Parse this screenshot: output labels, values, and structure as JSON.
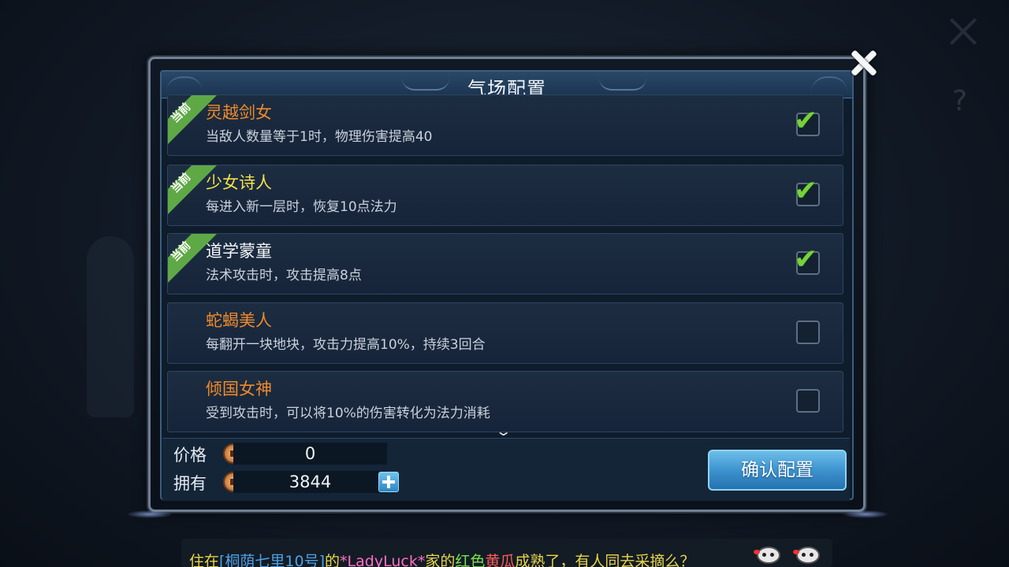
{
  "dialog": {
    "title": "气场配置"
  },
  "badge_text": "当前",
  "items": [
    {
      "name": "灵越剑女",
      "desc": "当敌人数量等于1时，物理伤害提高40",
      "current": true,
      "checked": true,
      "name_color": "#f08a2a"
    },
    {
      "name": "少女诗人",
      "desc": "每进入新一层时，恢复10点法力",
      "current": true,
      "checked": true,
      "name_color": "#f2e24a"
    },
    {
      "name": "道学蒙童",
      "desc": "法术攻击时，攻击提高8点",
      "current": true,
      "checked": true,
      "name_color": "#f4f6f8"
    },
    {
      "name": "蛇蝎美人",
      "desc": "每翻开一块地块，攻击力提高10%，持续3回合",
      "current": false,
      "checked": false,
      "name_color": "#f08a2a"
    },
    {
      "name": "倾国女神",
      "desc": "受到攻击时，可以将10%的伤害转化为法力消耗",
      "current": false,
      "checked": false,
      "name_color": "#f08a2a"
    }
  ],
  "footer": {
    "price_label": "价格",
    "price_value": "0",
    "owned_label": "拥有",
    "owned_value": "3844",
    "confirm_label": "确认配置"
  },
  "chat": {
    "p1": "住在",
    "p2": "[桐荫七里10号]",
    "p3": "的",
    "p4": "*LadyLuck*",
    "p5": "家的",
    "p6": "红色",
    "p7": "黄瓜",
    "p8": "成熟了，有人同去采摘么？"
  },
  "colors": {
    "accent": "#3d93cf",
    "current_badge": "#5ea946",
    "check": "#76d23b"
  }
}
